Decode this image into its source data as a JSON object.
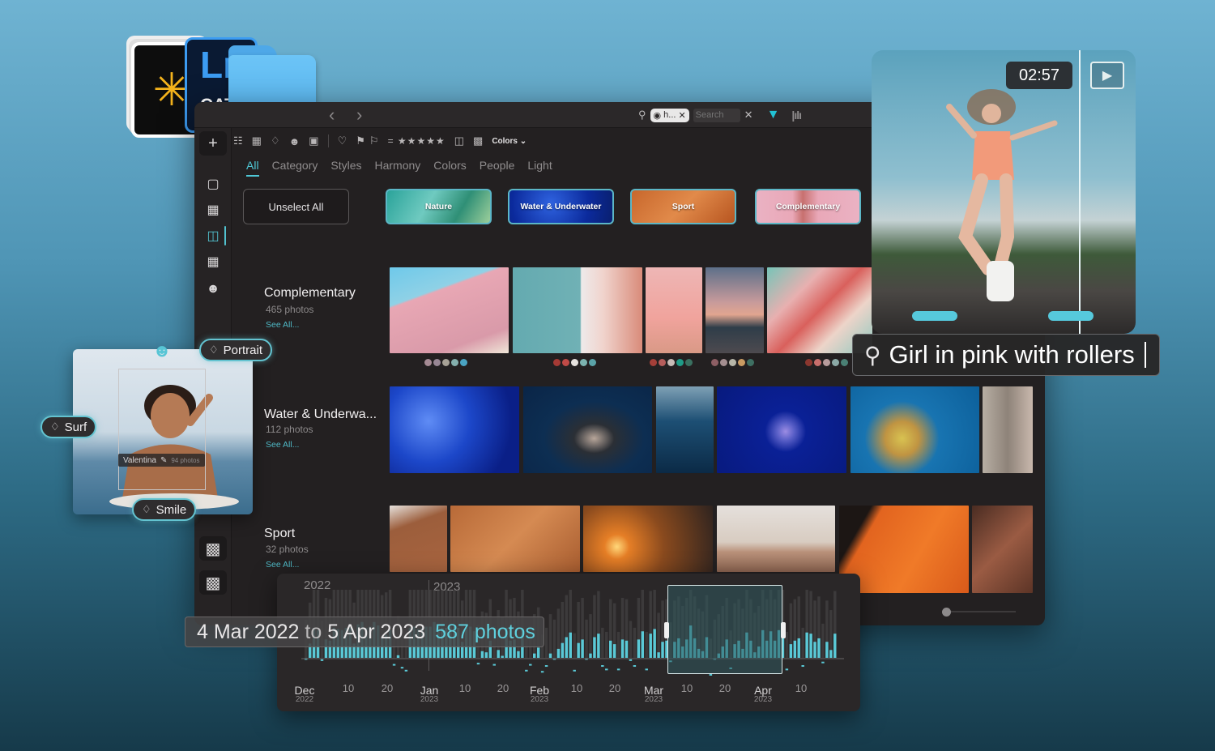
{
  "app_icons": {
    "catalog_glyph": "✳",
    "lr_label": "Lr",
    "lr_sub": "CAT"
  },
  "window": {
    "nav": {
      "back": "‹",
      "forward": "›"
    },
    "search": {
      "chip_label": "h...",
      "placeholder": "Search",
      "value": ""
    },
    "toolbar": {
      "rating_prefix": "=",
      "stars": "★★★★★",
      "colors_dropdown": "Colors ⌄"
    },
    "tabs": [
      {
        "label": "All",
        "active": true
      },
      {
        "label": "Category",
        "active": false
      },
      {
        "label": "Styles",
        "active": false
      },
      {
        "label": "Harmony",
        "active": false
      },
      {
        "label": "Colors",
        "active": false
      },
      {
        "label": "People",
        "active": false
      },
      {
        "label": "Light",
        "active": false
      }
    ],
    "unselect_all": "Unselect All",
    "category_chips": [
      {
        "label": "Nature"
      },
      {
        "label": "Water & Underwater"
      },
      {
        "label": "Sport"
      },
      {
        "label": "Complementary"
      }
    ],
    "rows": [
      {
        "title": "Complementary",
        "count": "465 photos",
        "see_all": "See All...",
        "palettes": [
          [
            "#a58a94",
            "#978694",
            "#a6a196",
            "#84afad",
            "#4aa4c3"
          ],
          [
            "#a53a35",
            "#c04a47",
            "#e7e3df",
            "#7cb3b0",
            "#5aa3a8"
          ],
          [
            "#a43f39",
            "#b55d5b",
            "#c7bcb7",
            "#1f9b87",
            "#3a7060"
          ],
          [
            "#8d5e64",
            "#a48e90",
            "#b7b6a8",
            "#c99b62",
            "#3e6f62"
          ],
          [
            "#8c372f",
            "#c86e6c",
            "#b79b9c",
            "#8ba9a6",
            "#4a7f74"
          ]
        ]
      },
      {
        "title": "Water & Underwa...",
        "count": "112 photos",
        "see_all": "See All..."
      },
      {
        "title": "Sport",
        "count": "32 photos",
        "see_all": "See All..."
      }
    ],
    "thumbnail_size_slider": 0.0
  },
  "preview": {
    "duration": "02:57",
    "play_icon": "▶",
    "query": "Girl in pink with rollers"
  },
  "face_card": {
    "person_name": "Valentina",
    "person_count": "94 photos",
    "tags": [
      "Portrait",
      "Surf",
      "Smile"
    ]
  },
  "timeline": {
    "years": [
      "2022",
      "2023"
    ],
    "range_from": "4 Mar 2022",
    "range_to_word": "to",
    "range_to": "5 Apr 2023",
    "range_count": "587 photos",
    "months": [
      {
        "name": "Dec",
        "year": "2022"
      },
      {
        "name": "Jan",
        "year": "2023"
      },
      {
        "name": "Feb",
        "year": "2023"
      },
      {
        "name": "Mar",
        "year": "2023"
      },
      {
        "name": "Apr",
        "year": "2023"
      }
    ],
    "day_ticks": [
      "10",
      "20",
      "10",
      "20",
      "10",
      "20",
      "10",
      "20",
      "10"
    ],
    "selection": {
      "start": "Mar 5 2023",
      "end": "Apr 5 2023"
    },
    "bars": [
      0.3,
      0.55,
      0.82,
      0.78,
      0.28,
      0.62,
      0.6,
      0.82,
      0.8,
      0.78,
      0.82,
      0.82,
      0.55,
      0.88,
      0.92,
      0.82,
      0.84,
      0.92,
      0.86,
      0.66,
      0.7,
      0.78,
      0.2,
      0.35,
      0.15,
      0.1,
      0.82,
      0.84,
      0.8,
      0.82,
      0.84,
      0.84,
      0.92,
      0.84,
      0.82,
      0.82,
      0.84,
      0.84,
      0.82,
      0.58,
      0.82,
      0.84,
      0.76,
      0.22,
      0.42,
      0.4,
      0.6,
      0.2,
      0.44,
      0.34,
      0.82,
      0.6,
      0.62,
      0.42,
      0.8,
      0.1,
      0.2,
      0.38,
      0.48,
      0.08,
      0.18,
      0.38,
      0.3,
      0.46,
      0.56,
      0.66,
      0.74,
      0.1,
      0.56,
      0.62,
      0.3,
      0.38,
      0.66,
      0.72,
      0.18,
      0.12,
      0.6,
      0.54,
      0.12,
      0.62,
      0.6,
      0.28,
      0.18,
      0.62,
      0.76,
      0.12,
      0.72,
      0.8,
      0.4,
      0.58,
      0.6,
      0.26,
      0.58,
      0.64,
      0.5,
      0.62,
      0.86,
      0.64,
      0.46,
      0.42,
      0.66,
      0.02,
      0.3,
      0.38,
      0.5,
      0.62,
      0.14,
      0.54,
      0.6,
      0.46,
      0.74,
      0.6,
      0.4,
      0.5,
      0.78,
      0.6,
      0.76,
      0.6,
      0.78,
      0.76,
      0.12,
      0.54,
      0.6,
      0.64,
      0.18,
      0.74,
      0.72,
      0.58,
      0.64,
      0.24,
      0.58,
      0.44,
      0.72
    ],
    "colors": {
      "bar": "#5ac9d6",
      "bar_bg": "#4a4748",
      "selection": "#2f5a5e"
    }
  },
  "colors": {
    "accent": "#4fc7d6",
    "window_bg": "#232021",
    "chip_border": "#5bb6c6"
  }
}
